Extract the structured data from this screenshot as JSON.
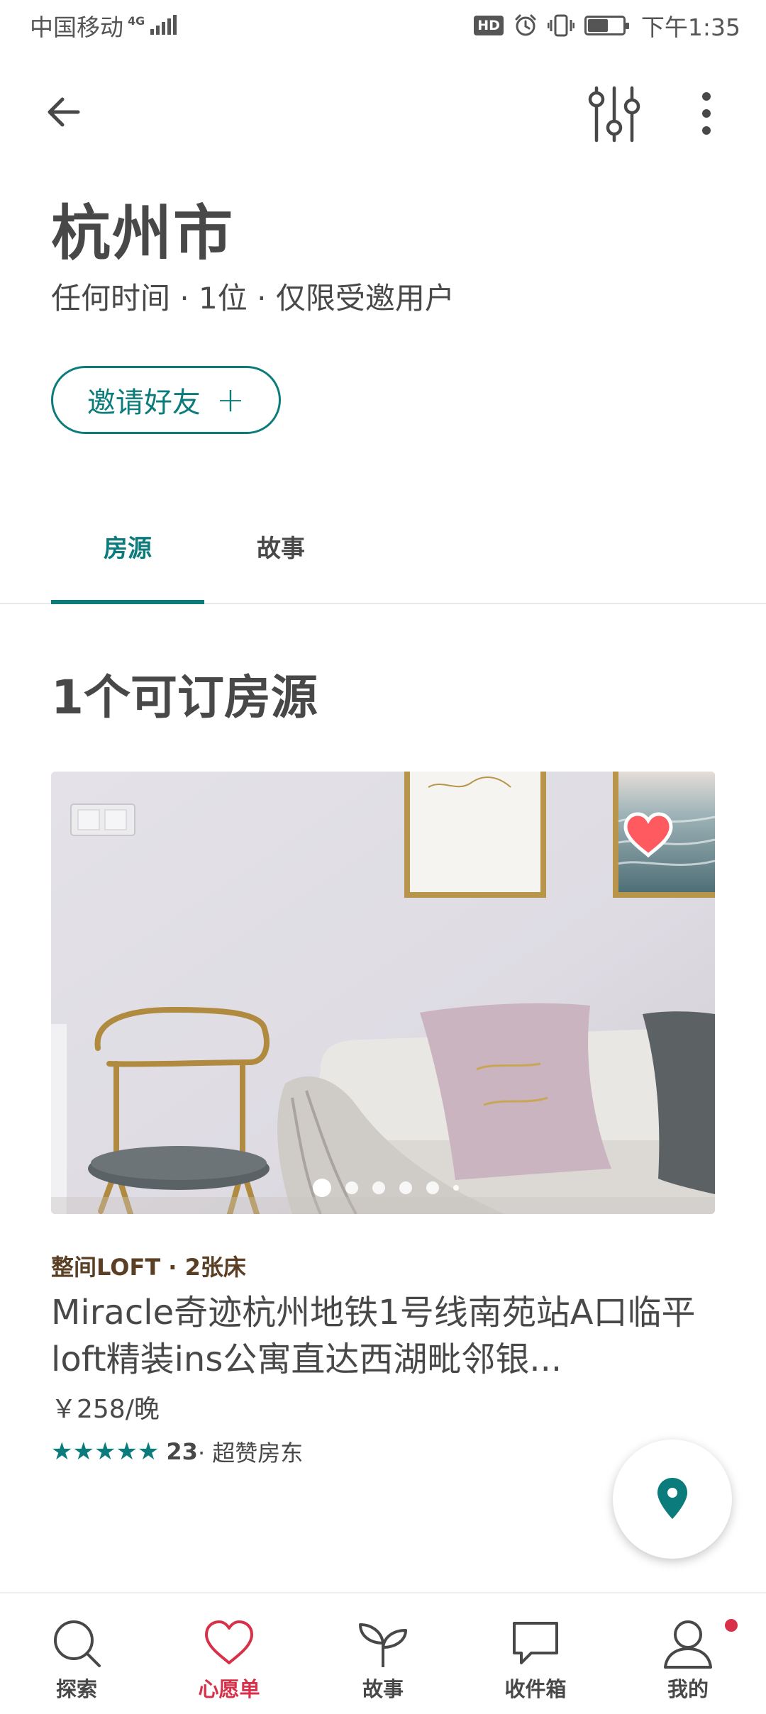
{
  "status_bar": {
    "carrier": "中国移动",
    "network": "4G",
    "hd_label": "HD",
    "time": "下午1:35"
  },
  "header": {
    "back_icon": "arrow-left-icon",
    "filter_icon": "sliders-icon",
    "more_icon": "more-vertical-icon"
  },
  "wishlist": {
    "title": "杭州市",
    "subtitle": "任何时间 · 1位 · 仅限受邀用户",
    "invite_label": "邀请好友",
    "invite_icon": "+"
  },
  "tabs": [
    {
      "label": "房源",
      "active": true
    },
    {
      "label": "故事",
      "active": false
    }
  ],
  "section_title": "1个可订房源",
  "listing": {
    "type": "整间LOFT · 2张床",
    "title": "Miracle奇迹杭州地铁1号线南苑站A口临平loft精装ins公寓直达西湖毗邻银...",
    "price": "￥258/晚",
    "stars": "★★★★★",
    "rating_value": 5,
    "review_count": "23",
    "host_badge": " · 超赞房东",
    "photo_count": 6,
    "photo_index": 1,
    "saved": true
  },
  "bottom_nav": [
    {
      "label": "探索",
      "icon": "search-icon",
      "active": false
    },
    {
      "label": "心愿单",
      "icon": "heart-icon",
      "active": true
    },
    {
      "label": "故事",
      "icon": "sprout-icon",
      "active": false
    },
    {
      "label": "收件箱",
      "icon": "chat-icon",
      "active": false
    },
    {
      "label": "我的",
      "icon": "profile-icon",
      "active": false,
      "badge": true
    }
  ],
  "colors": {
    "accent": "#0b7b7b",
    "active_nav": "#d9304a",
    "text": "#484848",
    "heart": "#ff5a5f"
  }
}
